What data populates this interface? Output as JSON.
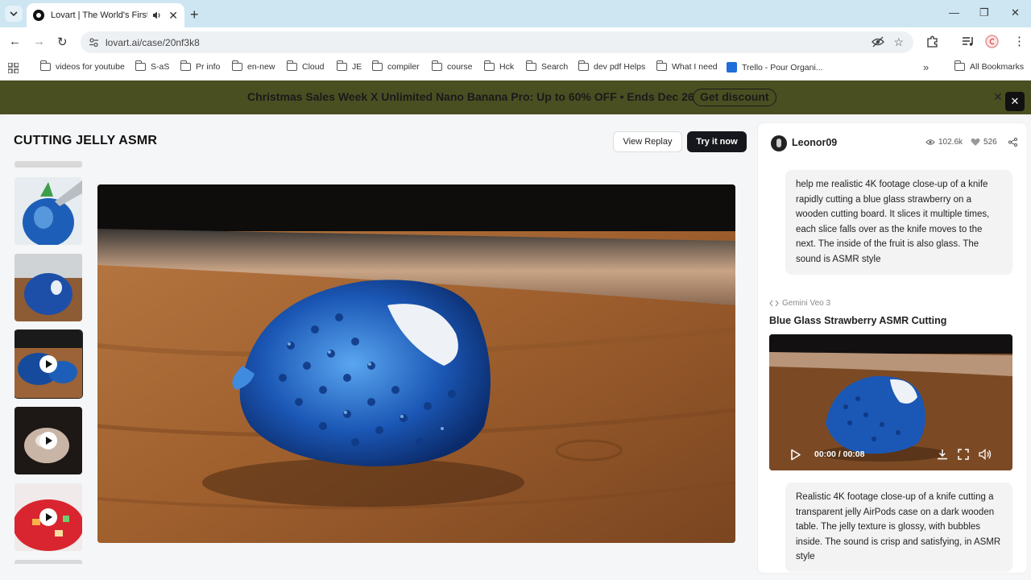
{
  "browser": {
    "tab_title": "Lovart | The World's First Design Agent",
    "url": "lovart.ai/case/20nf3k8",
    "bookmarks": [
      "videos for youtube",
      "S-aS",
      "Pr info",
      "en-new",
      "Cloud",
      "JE",
      "compiler",
      "course",
      "Hck",
      "Search",
      "dev pdf Helps",
      "What I need",
      "Trello - Pour Organi...",
      "All Bookmarks"
    ]
  },
  "banner": {
    "text": "Christmas Sales Week X Unlimited Nano Banana Pro: Up to 60% OFF • Ends Dec 26",
    "button": "Get discount"
  },
  "page": {
    "title": "CUTTING JELLY ASMR",
    "view_replay": "View Replay",
    "try_now": "Try it now"
  },
  "panel": {
    "author": "Leonor09",
    "views": "102.6k",
    "likes": "526",
    "prompt1": "help me realistic 4K footage close-up of a knife rapidly cutting a blue glass strawberry on a wooden cutting board. It slices it multiple times, each slice falls over as the knife moves to the next. The inside of the fruit is also glass. The sound is ASMR style",
    "model": "Gemini Veo 3",
    "video_title": "Blue Glass Strawberry ASMR Cutting",
    "video_time": "00:00 / 00:08",
    "prompt2": "Realistic 4K footage close-up of a knife cutting a transparent jelly AirPods case on a dark wooden table. The jelly texture is glossy, with bubbles inside. The sound is crisp and satisfying, in ASMR style"
  },
  "icons": {
    "accent": "#15171c",
    "banner_bg": "#4a4f22",
    "strawberry_blue": "#1d5fb8"
  }
}
